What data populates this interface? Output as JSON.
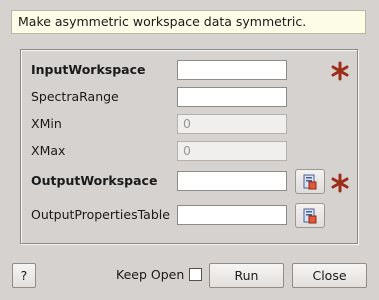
{
  "description": "Make asymmetric workspace data symmetric.",
  "properties": [
    {
      "label": "InputWorkspace",
      "value": "",
      "placeholder": ""
    },
    {
      "label": "SpectraRange",
      "value": "",
      "placeholder": ""
    },
    {
      "label": "XMin",
      "value": "0",
      "placeholder": ""
    },
    {
      "label": "XMax",
      "value": "0",
      "placeholder": ""
    },
    {
      "label": "OutputWorkspace",
      "value": "",
      "placeholder": ""
    },
    {
      "label": "OutputPropertiesTable",
      "value": "",
      "placeholder": ""
    }
  ],
  "required_mark_color": "#9b2d1a",
  "icons": {
    "required": "asterisk-icon",
    "browse": "workspace-browse-icon"
  },
  "buttons": {
    "help": "?",
    "keep_open": "Keep Open",
    "run": "Run",
    "close": "Close"
  },
  "keep_open_checked": false
}
